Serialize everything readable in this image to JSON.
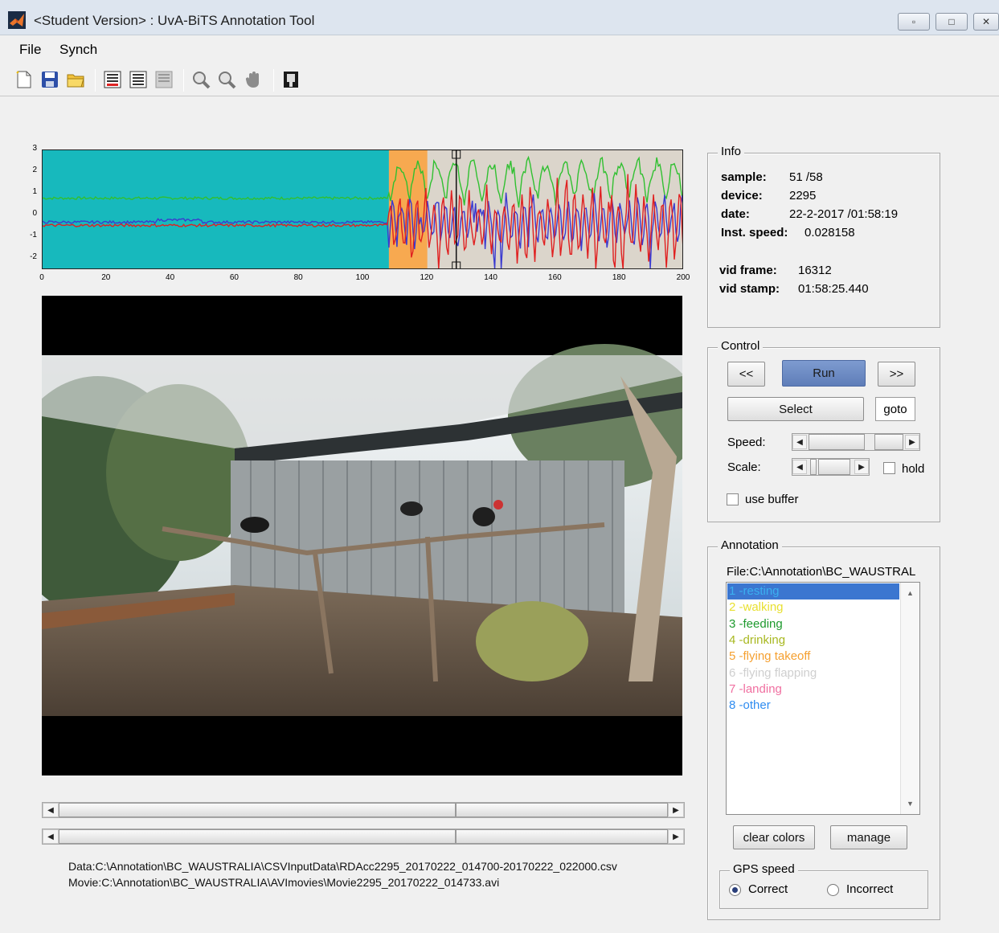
{
  "window": {
    "title": "<Student Version> : UvA-BiTS Annotation Tool",
    "minimize_icon": "minimize-icon",
    "maximize_icon": "maximize-icon",
    "close_icon": "close-icon"
  },
  "menu": {
    "file": "File",
    "synch": "Synch"
  },
  "toolbar": {
    "icons": [
      "new-file-icon",
      "save-icon",
      "open-folder-icon",
      "annotation-list-icon",
      "settings-list-icon",
      "disabled-list-icon",
      "zoom-in-icon",
      "zoom-out-icon",
      "pan-hand-icon",
      "datatip-icon"
    ]
  },
  "chart_data": {
    "type": "line",
    "xlim": [
      0,
      200
    ],
    "ylim": [
      -2.5,
      3
    ],
    "x_ticks": [
      "0",
      "20",
      "40",
      "60",
      "80",
      "100",
      "120",
      "140",
      "160",
      "180",
      "200"
    ],
    "y_ticks": [
      "3",
      "2",
      "1",
      "0",
      "-1",
      "-2"
    ],
    "segments": [
      {
        "from": 0,
        "to": 108,
        "color": "#17b9bd"
      },
      {
        "from": 108,
        "to": 120,
        "color": "#f7a950"
      },
      {
        "from": 120,
        "to": 200,
        "color": "#dbd5cb"
      }
    ],
    "cursor_x": 129,
    "series": [
      {
        "color": "#30c030",
        "baseline": 0.8,
        "amp": 1.2
      },
      {
        "color": "#3a3ad0",
        "baseline": -0.3,
        "amp": 0.9
      },
      {
        "color": "#e02020",
        "baseline": -0.45,
        "amp": 1.3
      }
    ]
  },
  "info": {
    "title": "Info",
    "sample_label": "sample:",
    "sample_value": "51 /58",
    "device_label": "device:",
    "device_value": "2295",
    "date_label": "date:",
    "date_value": "22-2-2017 /01:58:19",
    "speed_label": "Inst. speed:",
    "speed_value": "0.028158",
    "vidframe_label": "vid frame:",
    "vidframe_value": "16312",
    "vidstamp_label": "vid stamp:",
    "vidstamp_value": "01:58:25.440"
  },
  "control": {
    "title": "Control",
    "prev": "<<",
    "run": "Run",
    "next": ">>",
    "select": "Select",
    "goto": "goto",
    "speed_label": "Speed:",
    "scale_label": "Scale:",
    "hold_label": "hold",
    "use_buffer_label": "use buffer"
  },
  "annotation": {
    "title": "Annotation",
    "file": "File:C:\\Annotation\\BC_WAUSTRAL",
    "items": [
      {
        "label": "1 -resting",
        "color": "#3bb0f0",
        "selected": true
      },
      {
        "label": "2 -walking",
        "color": "#e8e030"
      },
      {
        "label": "3 -feeding",
        "color": "#1e9a2e"
      },
      {
        "label": "4 -drinking",
        "color": "#a8b820"
      },
      {
        "label": "5 -flying takeoff",
        "color": "#f5a030"
      },
      {
        "label": "6 -flying flapping",
        "color": "#cfcfcf"
      },
      {
        "label": "7 -landing",
        "color": "#f06fa0"
      },
      {
        "label": "8 -other",
        "color": "#2f8cf0"
      }
    ],
    "clear_colors": "clear colors",
    "manage": "manage"
  },
  "gps": {
    "title": "GPS speed",
    "correct": "Correct",
    "incorrect": "Incorrect",
    "selected": "correct"
  },
  "paths": {
    "data": "Data:C:\\Annotation\\BC_WAUSTRALIA\\CSVInputData\\RDAcc2295_20170222_014700-20170222_022000.csv",
    "movie": "Movie:C:\\Annotation\\BC_WAUSTRALIA\\AVImovies\\Movie2295_20170222_014733.avi"
  }
}
